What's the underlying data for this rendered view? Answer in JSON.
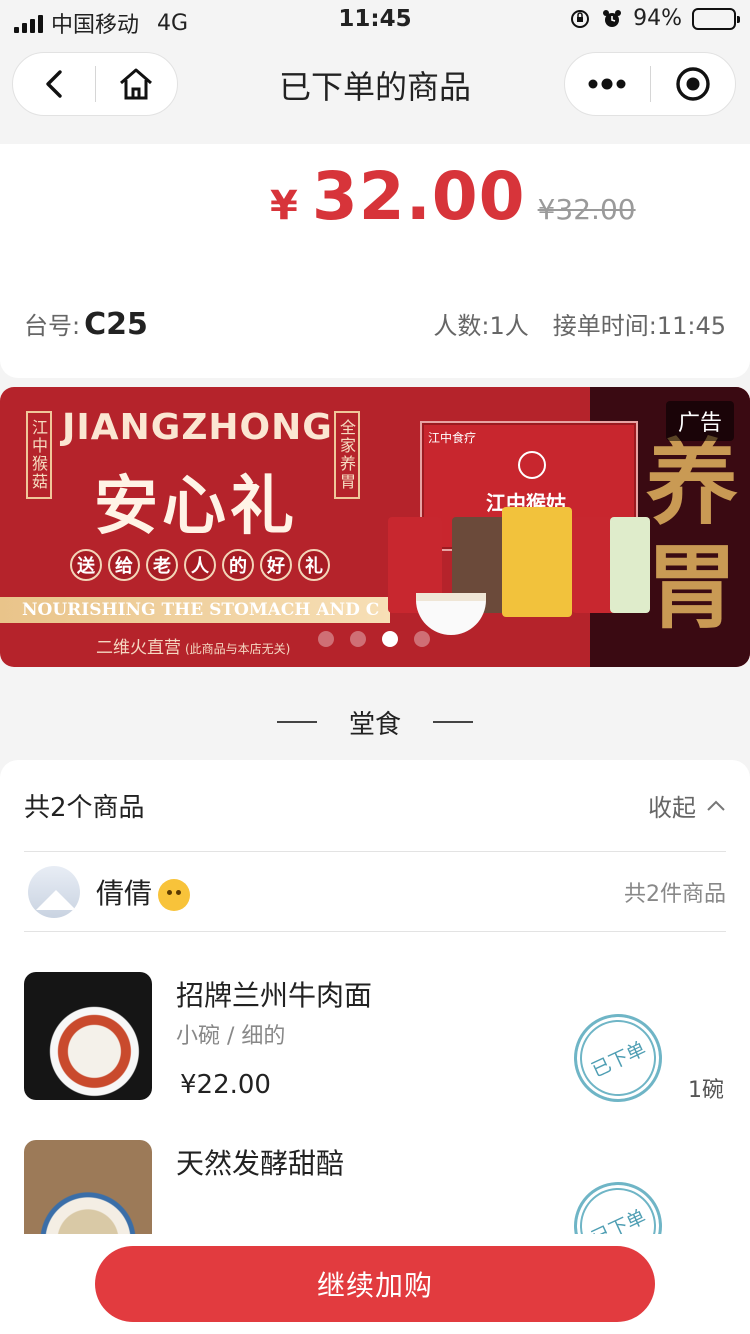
{
  "status_bar": {
    "carrier": "中国移动",
    "network": "4G",
    "time": "11:45",
    "battery_pct": "94%",
    "battery_level": 0.94
  },
  "nav": {
    "title": "已下单的商品",
    "icons": [
      "back-icon",
      "home-icon",
      "more-icon",
      "record-icon"
    ]
  },
  "order": {
    "currency": "¥",
    "amount": "32.00",
    "original_price": "¥32.00",
    "table_label": "台号:",
    "table_no": "C25",
    "people": "人数:1人",
    "order_time": "接单时间:11:45"
  },
  "banner": {
    "side_left": "江中猴菇",
    "side_right": "全家养胃",
    "brand_en": "JIANGZHONG",
    "headline": "安心礼",
    "gift_chars": [
      "送",
      "给",
      "老",
      "人",
      "的",
      "好",
      "礼"
    ],
    "strip_text": "NOURISHING THE STOMACH AND C",
    "box_brand": "江中猴姑",
    "box_logo": "江中食疗",
    "store": "二维火直营",
    "store_note": "(此商品与本店无关)",
    "ad_tag": "广告",
    "side_big": "养胃",
    "carousel_count": 4,
    "carousel_active": 3,
    "colors": {
      "red": "#b5232b",
      "dark": "#3a0a12",
      "gold": "#c99a54"
    }
  },
  "section": {
    "title": "堂食"
  },
  "items_card": {
    "count_label": "共2个商品",
    "collapse_label": "收起",
    "user": {
      "name": "倩倩",
      "item_count": "共2件商品"
    },
    "items": [
      {
        "name": "招牌兰州牛肉面",
        "spec": "小碗 / 细的",
        "price": "¥22.00",
        "status": "已下单",
        "qty": "1碗"
      },
      {
        "name": "天然发酵甜醅",
        "spec": "",
        "price": "",
        "status": "已下单",
        "qty": ""
      }
    ]
  },
  "cta": {
    "label": "继续加购"
  },
  "colors": {
    "accent": "#e23b3f",
    "price": "#d7343a",
    "stamp": "#6fb5c6"
  }
}
